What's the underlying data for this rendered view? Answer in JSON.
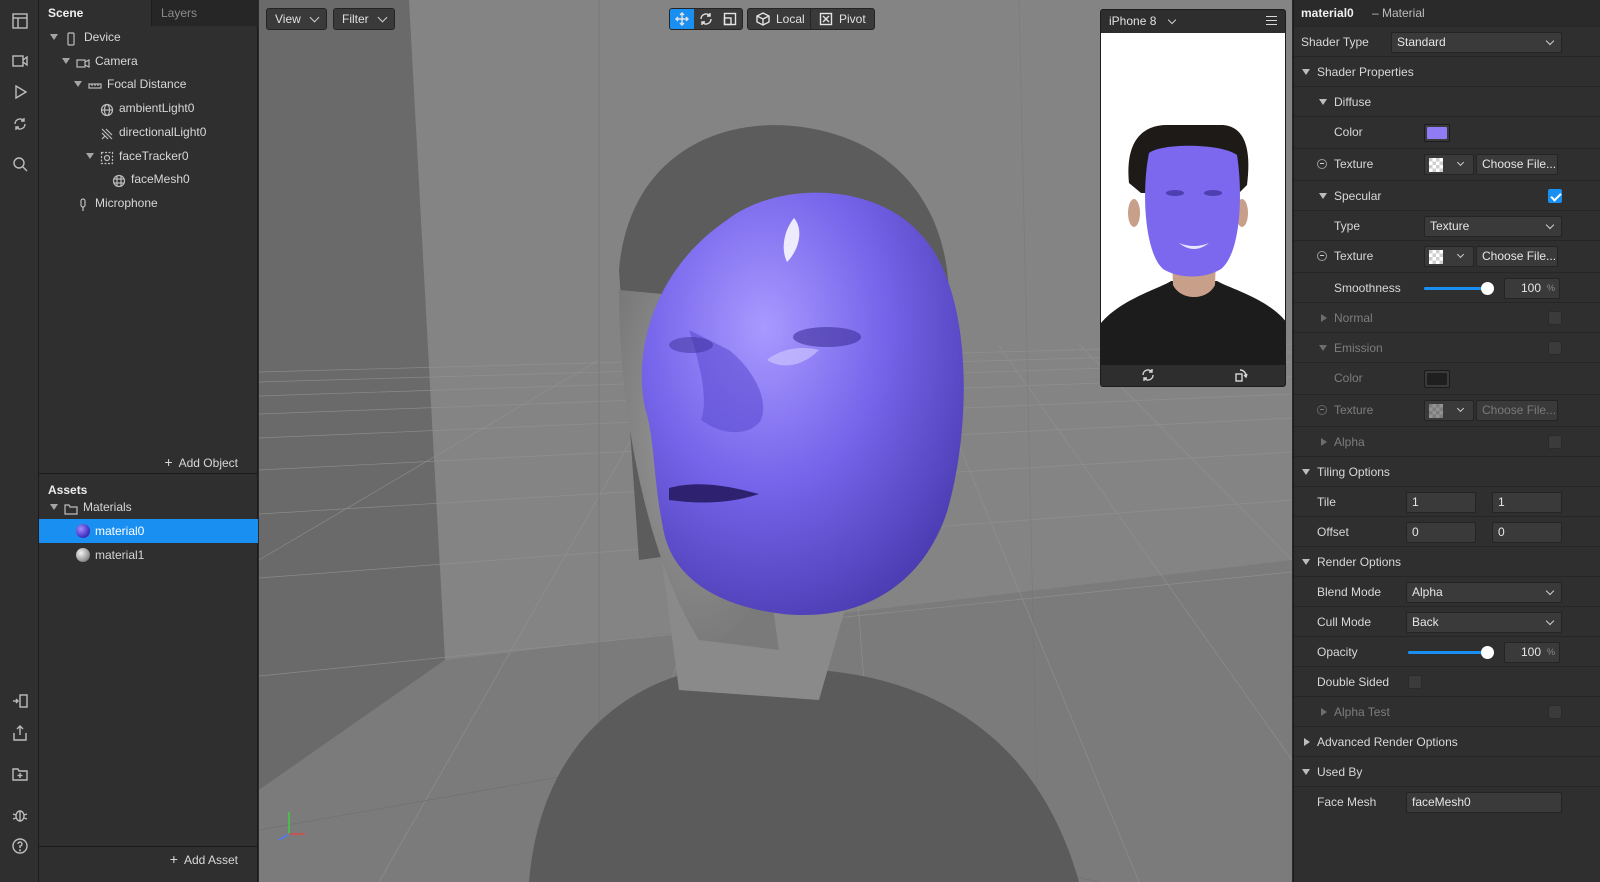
{
  "scene_panel": {
    "tabs": [
      "Scene",
      "Layers"
    ],
    "tree": [
      {
        "label": "Device",
        "icon": "phone-icon"
      },
      {
        "label": "Camera",
        "icon": "camera-icon"
      },
      {
        "label": "Focal Distance",
        "icon": "focal-distance-icon"
      },
      {
        "label": "ambientLight0",
        "icon": "globe-light-icon"
      },
      {
        "label": "directionalLight0",
        "icon": "directional-light-icon"
      },
      {
        "label": "faceTracker0",
        "icon": "face-tracker-icon"
      },
      {
        "label": "faceMesh0",
        "icon": "mesh-icon"
      },
      {
        "label": "Microphone",
        "icon": "microphone-icon"
      }
    ],
    "add_object": "Add Object"
  },
  "assets_panel": {
    "title": "Assets",
    "folder": "Materials",
    "items": [
      {
        "label": "material0",
        "color": "#5b46d8",
        "selected": true
      },
      {
        "label": "material1",
        "color": "#a8a8a8",
        "selected": false
      }
    ],
    "add_asset": "Add Asset"
  },
  "viewport": {
    "view_label": "View",
    "filter_label": "Filter",
    "local_label": "Local",
    "pivot_label": "Pivot",
    "device_label": "iPhone 8",
    "mask_color": "#7b68ee"
  },
  "inspector": {
    "title": "material0",
    "subtitle": "– Material",
    "shader_type_label": "Shader Type",
    "shader_type_value": "Standard",
    "shader_properties": "Shader Properties",
    "diffuse": "Diffuse",
    "color_label": "Color",
    "diffuse_color": "#8f7cf5",
    "texture_label": "Texture",
    "choose_file": "Choose File...",
    "specular": "Specular",
    "specular_checked": true,
    "type_label": "Type",
    "type_value": "Texture",
    "smoothness_label": "Smoothness",
    "smoothness_value": "100",
    "smoothness_fraction": 1.0,
    "percent": "%",
    "normal": "Normal",
    "emission": "Emission",
    "emission_color": "#1f1f1f",
    "alpha": "Alpha",
    "tiling_options": "Tiling Options",
    "tile_label": "Tile",
    "tile_x": "1",
    "tile_y": "1",
    "offset_label": "Offset",
    "offset_x": "0",
    "offset_y": "0",
    "render_options": "Render Options",
    "blend_mode_label": "Blend Mode",
    "blend_mode_value": "Alpha",
    "cull_mode_label": "Cull Mode",
    "cull_mode_value": "Back",
    "opacity_label": "Opacity",
    "opacity_value": "100",
    "opacity_fraction": 1.0,
    "double_sided_label": "Double Sided",
    "alpha_test": "Alpha Test",
    "advanced_render_options": "Advanced Render Options",
    "used_by": "Used By",
    "face_mesh_label": "Face Mesh",
    "face_mesh_value": "faceMesh0"
  }
}
